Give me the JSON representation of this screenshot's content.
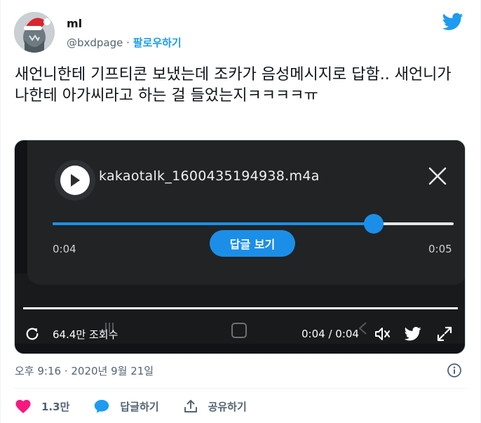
{
  "tweet": {
    "author_name": "ml",
    "handle": "@bxdpage",
    "separator": "·",
    "follow_label": "팔로우하기",
    "text": "새언니한테 기프티콘 보냈는데 조카가 음성메시지로 답함.. 새언니가 나한테 아가씨라고 하는 걸 들었는지ㅋㅋㅋㅋㅠ",
    "timestamp": "오후 9:16 · 2020년 9월 21일"
  },
  "media": {
    "filename": "kakaotalk_1600435194938.m4a",
    "time_elapsed": "0:04",
    "time_total": "0:05",
    "progress_fraction": 0.8,
    "reply_button_label": "답글 보기",
    "views_label": "64.4만 조회수",
    "video_timecode": "0:04 / 0:04"
  },
  "actions": {
    "like_count": "1.3만",
    "reply_label": "답글하기",
    "share_label": "공유하기"
  },
  "colors": {
    "brand_blue": "#1d9bf0",
    "like_pink": "#f91880",
    "player_blue": "#1b8fe8"
  },
  "icons": [
    "twitter-bird-icon",
    "play-icon",
    "close-icon",
    "replay-icon",
    "volume-icon",
    "twitter-small-icon",
    "expand-icon",
    "info-icon",
    "heart-icon",
    "reply-bubble-icon",
    "share-icon"
  ]
}
